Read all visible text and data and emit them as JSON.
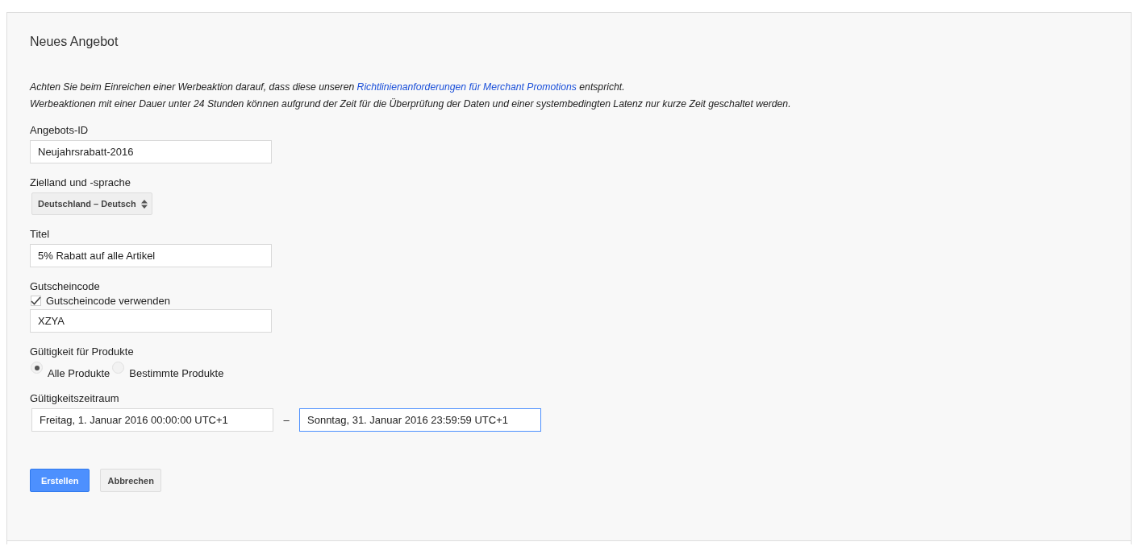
{
  "panel": {
    "title": "Neues Angebot"
  },
  "notice": [
    {
      "before": "Achten Sie beim Einreichen einer Werbeaktion darauf, dass diese unseren ",
      "link": "Richtlinienanforderungen für Merchant Promotions",
      "after": " entspricht."
    },
    {
      "before": "Werbeaktionen mit einer Dauer unter 24 Stunden können aufgrund der Zeit für die Überprüfung der Daten und einer systembedingten Latenz nur kurze Zeit geschaltet werden."
    }
  ],
  "fields": [
    {
      "kind": "text",
      "label": "Angebots-ID",
      "value": "Neujahrsrabatt-2016"
    },
    {
      "kind": "select",
      "label": "Zielland und -sprache",
      "value": "Deutschland – Deutsch"
    },
    {
      "kind": "text",
      "label": "Titel",
      "value": "5% Rabatt auf alle Artikel"
    },
    {
      "kind": "coupon",
      "label": "Gutscheincode",
      "checkbox": {
        "label": "Gutscheincode verwenden",
        "checked": true
      },
      "value": "XZYA"
    },
    {
      "kind": "radio",
      "label": "Gültigkeit für Produkte",
      "options": [
        {
          "label": "Alle Produkte",
          "selected": true
        },
        {
          "label": "Bestimmte Produkte",
          "selected": false
        }
      ]
    },
    {
      "kind": "range",
      "label": "Gültigkeitszeitraum",
      "start": {
        "value": "Freitag, 1. Januar 2016 00:00:00 UTC+1",
        "focused": false
      },
      "separator": "–",
      "end": {
        "value": "Sonntag, 31. Januar 2016 23:59:59 UTC+1",
        "focused": true
      }
    }
  ],
  "buttons": [
    {
      "label": "Erstellen",
      "primary": true
    },
    {
      "label": "Abbrechen",
      "primary": false
    }
  ]
}
